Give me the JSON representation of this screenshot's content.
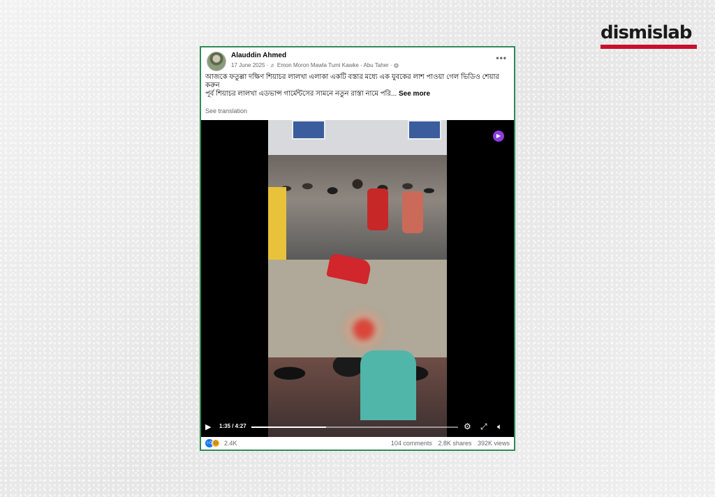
{
  "brand": {
    "logo_text": "dismislab",
    "accent": "#c8102e"
  },
  "post": {
    "author": "Alauddin Ahmed",
    "date": "17 June 2025",
    "audio": "Emon Moron Mawla Tumi Kawke",
    "audio_artist": "Abu Taher",
    "separator": "·",
    "more_label": "•••",
    "text_line1": "আজকে ফতুল্লা দক্ষিণ শিয়াচর লালখা এলাকা একটি বস্তার মধ্যে এক যুবকের লাশ পাওয়া গেল ভিডিও শেয়ার করুন",
    "text_line2": "পূর্ব শিয়াচর লালখা এডভান্স গার্মেন্টসের সামনে নতুন রাস্তা নামে পরি...",
    "see_more": "See more",
    "translation": "See translation"
  },
  "video": {
    "time": "1:35 / 4:27",
    "progress": 0.36,
    "icons": [
      "play-icon",
      "settings-icon",
      "fullscreen-icon",
      "volume-icon",
      "camera-icon"
    ]
  },
  "footer": {
    "reaction_count": "2.4K",
    "comments": "104 comments",
    "shares": "2.8K shares",
    "views": "392K views"
  }
}
